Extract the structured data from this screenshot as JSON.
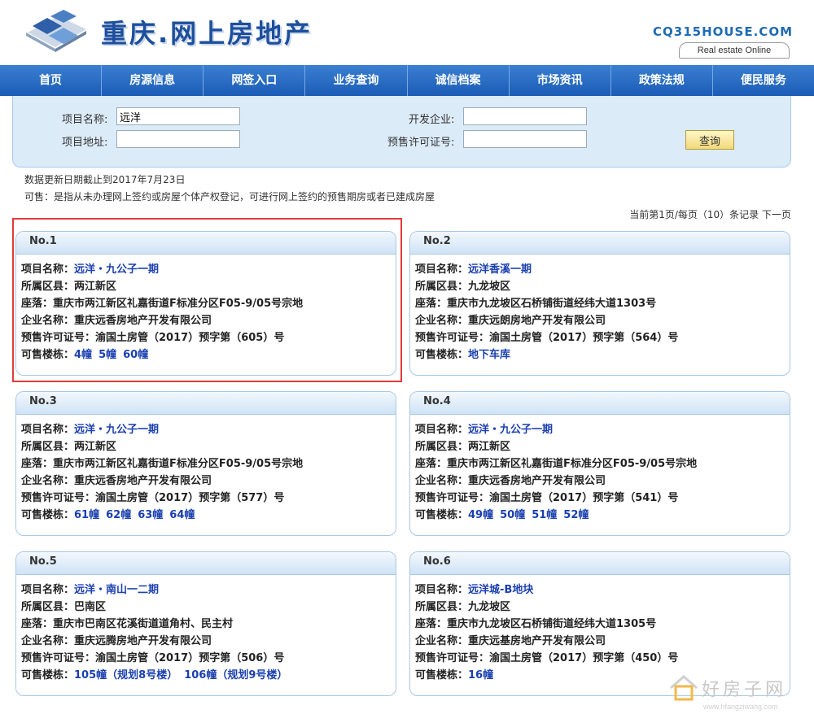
{
  "header": {
    "site_title": "重庆.网上房地产",
    "brand_code": "CQ315HOUSE.COM",
    "brand_tag": "Real estate Online"
  },
  "nav": [
    "首页",
    "房源信息",
    "网签入口",
    "业务查询",
    "诚信档案",
    "市场资讯",
    "政策法规",
    "便民服务"
  ],
  "search": {
    "project_name_label": "项目名称:",
    "project_name_value": "远洋",
    "project_addr_label": "项目地址:",
    "project_addr_value": "",
    "developer_label": "开发企业:",
    "developer_value": "",
    "permit_label": "预售许可证号:",
    "permit_value": "",
    "query_button": "查询"
  },
  "info": {
    "update_date": "数据更新日期截止到2017年7月23日",
    "note": "可售：是指从未办理网上签约或房屋个体产权登记，可进行网上签约的预售期房或者已建成房屋"
  },
  "pager": {
    "text": "当前第1页/每页（10）条记录",
    "next": "下一页"
  },
  "labels": {
    "project": "项目名称：",
    "district": "所属区县：",
    "location": "座落：",
    "company": "企业名称：",
    "permit": "预售许可证号：",
    "buildings": "可售楼栋："
  },
  "cards": [
    {
      "no": "No.1",
      "project": "远洋・九公子一期",
      "district": "两江新区",
      "location": "重庆市两江新区礼嘉街道F标准分区F05-9/05号宗地",
      "company": "重庆远香房地产开发有限公司",
      "permit": "渝国土房管（2017）预字第（605）号",
      "buildings": [
        "4幢",
        "5幢",
        "60幢"
      ]
    },
    {
      "no": "No.2",
      "project": "远洋香溪一期",
      "district": "九龙坡区",
      "location": "重庆市九龙坡区石桥铺街道经纬大道1303号",
      "company": "重庆远朗房地产开发有限公司",
      "permit": "渝国土房管（2017）预字第（564）号",
      "buildings": [
        "地下车库"
      ]
    },
    {
      "no": "No.3",
      "project": "远洋・九公子一期",
      "district": "两江新区",
      "location": "重庆市两江新区礼嘉街道F标准分区F05-9/05号宗地",
      "company": "重庆远香房地产开发有限公司",
      "permit": "渝国土房管（2017）预字第（577）号",
      "buildings": [
        "61幢",
        "62幢",
        "63幢",
        "64幢"
      ]
    },
    {
      "no": "No.4",
      "project": "远洋・九公子一期",
      "district": "两江新区",
      "location": "重庆市两江新区礼嘉街道F标准分区F05-9/05号宗地",
      "company": "重庆远香房地产开发有限公司",
      "permit": "渝国土房管（2017）预字第（541）号",
      "buildings": [
        "49幢",
        "50幢",
        "51幢",
        "52幢"
      ]
    },
    {
      "no": "No.5",
      "project": "远洋・南山一二期",
      "district": "巴南区",
      "location": "重庆市巴南区花溪街道道角村、民主村",
      "company": "重庆远腾房地产开发有限公司",
      "permit": "渝国土房管（2017）预字第（506）号",
      "buildings": [
        "105幢（规划8号楼）",
        "106幢（规划9号楼）"
      ]
    },
    {
      "no": "No.6",
      "project": "远洋城-B地块",
      "district": "九龙坡区",
      "location": "重庆市九龙坡区石桥铺街道经纬大道1305号",
      "company": "重庆远基房地产开发有限公司",
      "permit": "渝国土房管（2017）预字第（450）号",
      "buildings": [
        "16幢"
      ]
    }
  ],
  "watermark": {
    "text": "好房子网",
    "url": "www.hfangziwang.com"
  },
  "colors": {
    "nav_bg": "#1b5cb5",
    "link": "#1a3fb0",
    "highlight": "#e23b3b"
  }
}
